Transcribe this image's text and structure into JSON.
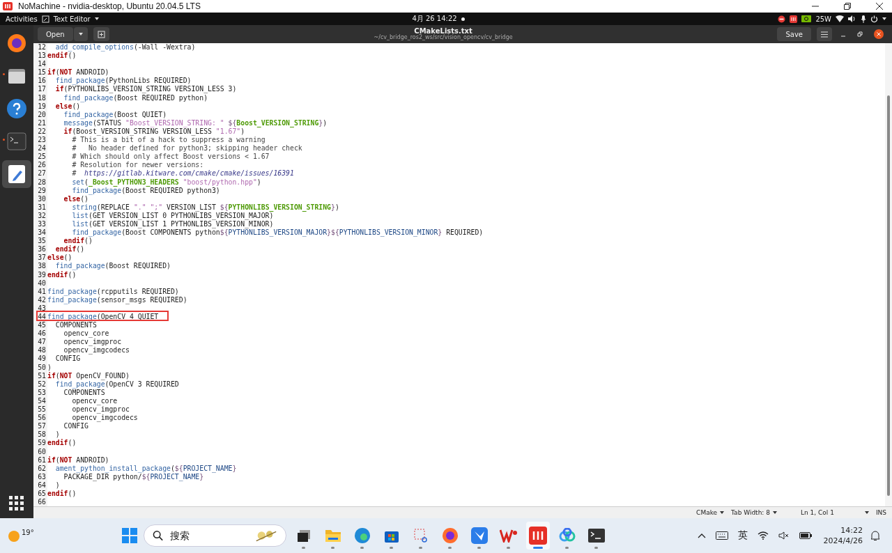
{
  "window": {
    "title": "NoMachine - nvidia-desktop, Ubuntu 20.04.5 LTS"
  },
  "top_bar": {
    "activities": "Activities",
    "app_menu": "Text Editor",
    "clock": "4月 26  14:22",
    "power_reading": "25W"
  },
  "header": {
    "open_button": "Open",
    "title": "CMakeLists.txt",
    "path": "~/cv_bridge_ros2_ws/src/vision_opencv/cv_bridge",
    "save_button": "Save"
  },
  "dock": [
    {
      "kind": "firefox",
      "selected": false
    },
    {
      "kind": "files",
      "selected": false
    },
    {
      "kind": "help",
      "selected": false
    },
    {
      "kind": "terminal",
      "selected": false
    },
    {
      "kind": "editor",
      "selected": true
    }
  ],
  "lines": [
    {
      "number": "12",
      "highlighted": false,
      "tokens": [
        {
          "kind": "fn",
          "text": "  add_compile_options"
        },
        {
          "kind": "plain",
          "text": "(-Wall -Wextra)"
        }
      ]
    },
    {
      "number": "13",
      "highlighted": false,
      "tokens": [
        {
          "kind": "kw",
          "text": "endif"
        },
        {
          "kind": "plain",
          "text": "()"
        }
      ]
    },
    {
      "number": "14",
      "highlighted": false
    },
    {
      "number": "15",
      "highlighted": false,
      "tokens": [
        {
          "kind": "kw",
          "text": "if"
        },
        {
          "kind": "plain",
          "text": "("
        },
        {
          "kind": "kw",
          "text": "NOT"
        },
        {
          "kind": "plain",
          "text": " ANDROID)"
        }
      ]
    },
    {
      "number": "16",
      "highlighted": false,
      "tokens": [
        {
          "kind": "fn",
          "text": "  find_package"
        },
        {
          "kind": "plain",
          "text": "(PythonLibs REQUIRED)"
        }
      ]
    },
    {
      "number": "17",
      "highlighted": false,
      "tokens": [
        {
          "kind": "kw",
          "text": "  if"
        },
        {
          "kind": "plain",
          "text": "(PYTHONLIBS_VERSION_STRING VERSION_LESS 3)"
        }
      ]
    },
    {
      "number": "18",
      "highlighted": false,
      "tokens": [
        {
          "kind": "fn",
          "text": "    find_package"
        },
        {
          "kind": "plain",
          "text": "(Boost REQUIRED python)"
        }
      ]
    },
    {
      "number": "19",
      "highlighted": false,
      "tokens": [
        {
          "kind": "kw",
          "text": "  else"
        },
        {
          "kind": "plain",
          "text": "()"
        }
      ]
    },
    {
      "number": "20",
      "highlighted": false,
      "tokens": [
        {
          "kind": "fn",
          "text": "    find_package"
        },
        {
          "kind": "plain",
          "text": "(Boost QUIET)"
        }
      ]
    },
    {
      "number": "21",
      "highlighted": false,
      "tokens": [
        {
          "kind": "fn",
          "text": "    message"
        },
        {
          "kind": "plain",
          "text": "(STATUS "
        },
        {
          "kind": "str",
          "text": "\"Boost_VERSION_STRING: \""
        },
        {
          "kind": "dollar",
          "text": " ${"
        },
        {
          "kind": "var",
          "text": "Boost_VERSION_STRING"
        },
        {
          "kind": "dollar",
          "text": "}"
        },
        {
          "kind": "plain",
          "text": ")"
        }
      ]
    },
    {
      "number": "22",
      "highlighted": false,
      "tokens": [
        {
          "kind": "kw",
          "text": "    if"
        },
        {
          "kind": "plain",
          "text": "(Boost_VERSION_STRING VERSION_LESS "
        },
        {
          "kind": "str",
          "text": "\"1.67\""
        },
        {
          "kind": "plain",
          "text": ")"
        }
      ]
    },
    {
      "number": "23",
      "highlighted": false,
      "tokens": [
        {
          "kind": "comment",
          "text": "      # This is a bit of a hack to suppress a warning"
        }
      ]
    },
    {
      "number": "24",
      "highlighted": false,
      "tokens": [
        {
          "kind": "comment",
          "text": "      #   No header defined for python3; skipping header check"
        }
      ]
    },
    {
      "number": "25",
      "highlighted": false,
      "tokens": [
        {
          "kind": "comment",
          "text": "      # Which should only affect Boost versions < 1.67"
        }
      ]
    },
    {
      "number": "26",
      "highlighted": false,
      "tokens": [
        {
          "kind": "comment",
          "text": "      # Resolution for newer versions:"
        }
      ]
    },
    {
      "number": "27",
      "highlighted": false,
      "tokens": [
        {
          "kind": "comment",
          "text": "      #"
        },
        {
          "kind": "url",
          "text": "  https://gitlab.kitware.com/cmake/cmake/issues/16391"
        }
      ]
    },
    {
      "number": "28",
      "highlighted": false,
      "tokens": [
        {
          "kind": "fn",
          "text": "      set"
        },
        {
          "kind": "plain",
          "text": "("
        },
        {
          "kind": "var",
          "text": "_Boost_PYTHON3_HEADERS"
        },
        {
          "kind": "str",
          "text": " \"boost/python.hpp\""
        },
        {
          "kind": "plain",
          "text": ")"
        }
      ]
    },
    {
      "number": "29",
      "highlighted": false,
      "tokens": [
        {
          "kind": "fn",
          "text": "      find_package"
        },
        {
          "kind": "plain",
          "text": "(Boost REQUIRED python3)"
        }
      ]
    },
    {
      "number": "30",
      "highlighted": false,
      "tokens": [
        {
          "kind": "kw",
          "text": "    else"
        },
        {
          "kind": "plain",
          "text": "()"
        }
      ]
    },
    {
      "number": "31",
      "highlighted": false,
      "tokens": [
        {
          "kind": "fn",
          "text": "      string"
        },
        {
          "kind": "plain",
          "text": "(REPLACE "
        },
        {
          "kind": "str",
          "text": "\".\" \";\""
        },
        {
          "kind": "plain",
          "text": " VERSION_LIST "
        },
        {
          "kind": "dollar",
          "text": "${"
        },
        {
          "kind": "var",
          "text": "PYTHONLIBS_VERSION_STRING"
        },
        {
          "kind": "dollar",
          "text": "}"
        },
        {
          "kind": "plain",
          "text": ")"
        }
      ]
    },
    {
      "number": "32",
      "highlighted": false,
      "tokens": [
        {
          "kind": "fn",
          "text": "      list"
        },
        {
          "kind": "plain",
          "text": "(GET VERSION_LIST 0 PYTHONLIBS_VERSION_MAJOR)"
        }
      ]
    },
    {
      "number": "33",
      "highlighted": false,
      "tokens": [
        {
          "kind": "fn",
          "text": "      list"
        },
        {
          "kind": "plain",
          "text": "(GET VERSION_LIST 1 PYTHONLIBS_VERSION_MINOR)"
        }
      ]
    },
    {
      "number": "34",
      "highlighted": false,
      "tokens": [
        {
          "kind": "fn",
          "text": "      find_package"
        },
        {
          "kind": "plain",
          "text": "(Boost COMPONENTS python"
        },
        {
          "kind": "dollar",
          "text": "${"
        },
        {
          "kind": "var2",
          "text": "PYTHONLIBS_VERSION_MAJOR"
        },
        {
          "kind": "dollar",
          "text": "}${"
        },
        {
          "kind": "var2",
          "text": "PYTHONLIBS_VERSION_MINOR"
        },
        {
          "kind": "dollar",
          "text": "}"
        },
        {
          "kind": "plain",
          "text": " REQUIRED)"
        }
      ]
    },
    {
      "number": "35",
      "highlighted": false,
      "tokens": [
        {
          "kind": "kw",
          "text": "    endif"
        },
        {
          "kind": "plain",
          "text": "()"
        }
      ]
    },
    {
      "number": "36",
      "highlighted": false,
      "tokens": [
        {
          "kind": "kw",
          "text": "  endif"
        },
        {
          "kind": "plain",
          "text": "()"
        }
      ]
    },
    {
      "number": "37",
      "highlighted": false,
      "tokens": [
        {
          "kind": "kw",
          "text": "else"
        },
        {
          "kind": "plain",
          "text": "()"
        }
      ]
    },
    {
      "number": "38",
      "highlighted": false,
      "tokens": [
        {
          "kind": "fn",
          "text": "  find_package"
        },
        {
          "kind": "plain",
          "text": "(Boost REQUIRED)"
        }
      ]
    },
    {
      "number": "39",
      "highlighted": false,
      "tokens": [
        {
          "kind": "kw",
          "text": "endif"
        },
        {
          "kind": "plain",
          "text": "()"
        }
      ]
    },
    {
      "number": "40",
      "highlighted": false
    },
    {
      "number": "41",
      "highlighted": false,
      "tokens": [
        {
          "kind": "fn",
          "text": "find_package"
        },
        {
          "kind": "plain",
          "text": "(rcpputils REQUIRED)"
        }
      ]
    },
    {
      "number": "42",
      "highlighted": false,
      "tokens": [
        {
          "kind": "fn",
          "text": "find_package"
        },
        {
          "kind": "plain",
          "text": "(sensor_msgs REQUIRED)"
        }
      ]
    },
    {
      "number": "43",
      "highlighted": false
    },
    {
      "number": "44",
      "highlighted": true,
      "tokens": [
        {
          "kind": "fn",
          "text": "find_package"
        },
        {
          "kind": "plain",
          "text": "(OpenCV 4 QUIET"
        }
      ]
    },
    {
      "number": "45",
      "highlighted": false,
      "tokens": [
        {
          "kind": "plain",
          "text": "  COMPONENTS"
        }
      ]
    },
    {
      "number": "46",
      "highlighted": false,
      "tokens": [
        {
          "kind": "plain",
          "text": "    opencv_core"
        }
      ]
    },
    {
      "number": "47",
      "highlighted": false,
      "tokens": [
        {
          "kind": "plain",
          "text": "    opencv_imgproc"
        }
      ]
    },
    {
      "number": "48",
      "highlighted": false,
      "tokens": [
        {
          "kind": "plain",
          "text": "    opencv_imgcodecs"
        }
      ]
    },
    {
      "number": "49",
      "highlighted": false,
      "tokens": [
        {
          "kind": "plain",
          "text": "  CONFIG"
        }
      ]
    },
    {
      "number": "50",
      "highlighted": false,
      "tokens": [
        {
          "kind": "plain",
          "text": ")"
        }
      ]
    },
    {
      "number": "51",
      "highlighted": false,
      "tokens": [
        {
          "kind": "kw",
          "text": "if"
        },
        {
          "kind": "plain",
          "text": "("
        },
        {
          "kind": "kw",
          "text": "NOT"
        },
        {
          "kind": "plain",
          "text": " OpenCV_FOUND)"
        }
      ]
    },
    {
      "number": "52",
      "highlighted": false,
      "tokens": [
        {
          "kind": "fn",
          "text": "  find_package"
        },
        {
          "kind": "plain",
          "text": "(OpenCV 3 REQUIRED"
        }
      ]
    },
    {
      "number": "53",
      "highlighted": false,
      "tokens": [
        {
          "kind": "plain",
          "text": "    COMPONENTS"
        }
      ]
    },
    {
      "number": "54",
      "highlighted": false,
      "tokens": [
        {
          "kind": "plain",
          "text": "      opencv_core"
        }
      ]
    },
    {
      "number": "55",
      "highlighted": false,
      "tokens": [
        {
          "kind": "plain",
          "text": "      opencv_imgproc"
        }
      ]
    },
    {
      "number": "56",
      "highlighted": false,
      "tokens": [
        {
          "kind": "plain",
          "text": "      opencv_imgcodecs"
        }
      ]
    },
    {
      "number": "57",
      "highlighted": false,
      "tokens": [
        {
          "kind": "plain",
          "text": "    CONFIG"
        }
      ]
    },
    {
      "number": "58",
      "highlighted": false,
      "tokens": [
        {
          "kind": "plain",
          "text": "  )"
        }
      ]
    },
    {
      "number": "59",
      "highlighted": false,
      "tokens": [
        {
          "kind": "kw",
          "text": "endif"
        },
        {
          "kind": "plain",
          "text": "()"
        }
      ]
    },
    {
      "number": "60",
      "highlighted": false
    },
    {
      "number": "61",
      "highlighted": false,
      "tokens": [
        {
          "kind": "kw",
          "text": "if"
        },
        {
          "kind": "plain",
          "text": "("
        },
        {
          "kind": "kw",
          "text": "NOT"
        },
        {
          "kind": "plain",
          "text": " ANDROID)"
        }
      ]
    },
    {
      "number": "62",
      "highlighted": false,
      "tokens": [
        {
          "kind": "fn",
          "text": "  ament_python_install_package"
        },
        {
          "kind": "plain",
          "text": "("
        },
        {
          "kind": "dollar",
          "text": "${"
        },
        {
          "kind": "var2",
          "text": "PROJECT_NAME"
        },
        {
          "kind": "dollar",
          "text": "}"
        }
      ]
    },
    {
      "number": "63",
      "highlighted": false,
      "tokens": [
        {
          "kind": "plain",
          "text": "    PACKAGE_DIR python/"
        },
        {
          "kind": "dollar",
          "text": "${"
        },
        {
          "kind": "var2",
          "text": "PROJECT_NAME"
        },
        {
          "kind": "dollar",
          "text": "}"
        }
      ]
    },
    {
      "number": "64",
      "highlighted": false,
      "tokens": [
        {
          "kind": "plain",
          "text": "  )"
        }
      ]
    },
    {
      "number": "65",
      "highlighted": false,
      "tokens": [
        {
          "kind": "kw",
          "text": "endif"
        },
        {
          "kind": "plain",
          "text": "()"
        }
      ]
    },
    {
      "number": "66",
      "highlighted": false
    }
  ],
  "status_bar": {
    "language": "CMake",
    "tab_width": "Tab Width: 8",
    "position": "Ln 1, Col 1",
    "mode": "INS"
  },
  "taskbar": {
    "weather": "19°",
    "search_placeholder": "搜索",
    "input_method": "英",
    "time": "14:22",
    "date": "2024/4/26",
    "apps": [
      {
        "kind": "window",
        "active": false
      },
      {
        "kind": "folder",
        "active": false
      },
      {
        "kind": "edge",
        "active": false
      },
      {
        "kind": "store",
        "active": false
      },
      {
        "kind": "snip",
        "active": false
      },
      {
        "kind": "firefox",
        "active": false
      },
      {
        "kind": "bird",
        "active": false
      },
      {
        "kind": "wps",
        "active": false
      },
      {
        "kind": "nomachine",
        "active": true
      },
      {
        "kind": "cloud",
        "active": false
      },
      {
        "kind": "terminal",
        "active": false
      }
    ]
  }
}
